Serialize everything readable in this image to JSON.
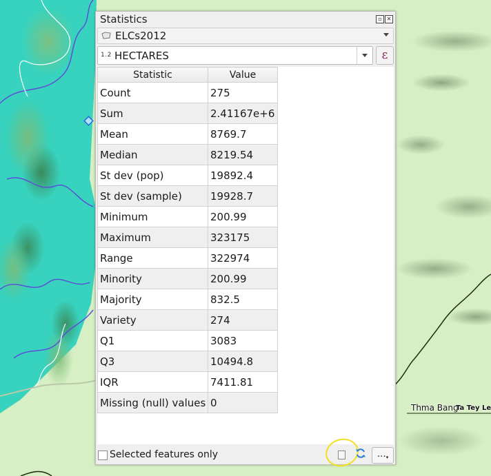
{
  "panel": {
    "title": "Statistics",
    "layer": "ELCs2012",
    "field_type": "1.2",
    "field": "HECTARES",
    "expression_button": "ε",
    "table": {
      "headers": [
        "Statistic",
        "Value"
      ],
      "rows": [
        {
          "statistic": "Count",
          "value": "275"
        },
        {
          "statistic": "Sum",
          "value": "2.41167e+6"
        },
        {
          "statistic": "Mean",
          "value": "8769.7"
        },
        {
          "statistic": "Median",
          "value": "8219.54"
        },
        {
          "statistic": "St dev (pop)",
          "value": "19892.4"
        },
        {
          "statistic": "St dev (sample)",
          "value": "19928.7"
        },
        {
          "statistic": "Minimum",
          "value": "200.99"
        },
        {
          "statistic": "Maximum",
          "value": "323175"
        },
        {
          "statistic": "Range",
          "value": "322974"
        },
        {
          "statistic": "Minority",
          "value": "200.99"
        },
        {
          "statistic": "Majority",
          "value": "832.5"
        },
        {
          "statistic": "Variety",
          "value": "274"
        },
        {
          "statistic": "Q1",
          "value": "3083"
        },
        {
          "statistic": "Q3",
          "value": "10494.8"
        },
        {
          "statistic": "IQR",
          "value": "7411.81"
        },
        {
          "statistic": "Missing (null) values",
          "value": "0"
        }
      ]
    },
    "selected_only_label": "Selected features only",
    "selected_only_checked": false,
    "more_button": "…"
  },
  "map": {
    "labels": {
      "thma_bang": "Thma Bang",
      "ta_tey_leu": "Ta Tey Leu"
    }
  },
  "colors": {
    "reserve_fill": "#38d3be",
    "terrain": "#d7efc4",
    "highlight_circle": "#f2df1f",
    "expression_icon": "#9a2060"
  }
}
